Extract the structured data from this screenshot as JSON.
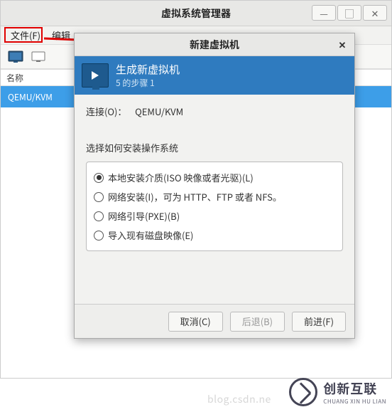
{
  "main_window": {
    "title": "虚拟系统管理器",
    "menubar": {
      "file": "文件(F)",
      "edit": "编辑"
    },
    "list": {
      "header_name": "名称",
      "row0": "QEMU/KVM"
    }
  },
  "dialog": {
    "title": "新建虚拟机",
    "banner": {
      "heading": "生成新虚拟机",
      "step": "5 的步骤 1"
    },
    "connection_label": "连接(O)：",
    "connection_value": "QEMU/KVM",
    "choose_label": "选择如何安装操作系统",
    "options": {
      "local": "本地安装介质(ISO 映像或者光驱)(L)",
      "network": "网络安装(I)，可为 HTTP、FTP 或者 NFS。",
      "pxe": "网络引导(PXE)(B)",
      "import": "导入现有磁盘映像(E)"
    },
    "buttons": {
      "cancel": "取消(C)",
      "back": "后退(B)",
      "forward": "前进(F)"
    }
  },
  "watermark": {
    "url": "blog.csdn.ne",
    "brand_cn": "创新互联",
    "brand_en": "CHUANG XIN HU LIAN"
  }
}
